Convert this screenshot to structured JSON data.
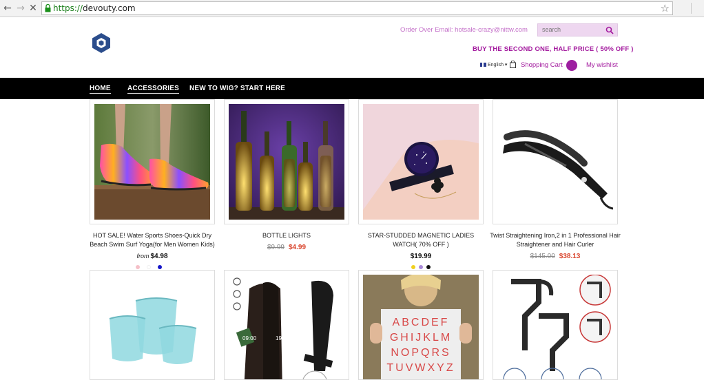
{
  "browser": {
    "url_scheme": "https://",
    "url_host": "devouty.com"
  },
  "header": {
    "order_email": "Order Over Email: hotsale-crazy@nittw.com",
    "search_placeholder": "search",
    "promo": "BUY THE SECOND ONE, HALF PRICE ( 50% OFF )",
    "language": "English",
    "cart_label": "Shopping Cart",
    "wishlist_label": "My wishlist"
  },
  "nav": {
    "items": [
      "HOME",
      "ACCESSORIES",
      "NEW TO WIG? START HERE"
    ]
  },
  "products": [
    {
      "title": "HOT SALE! Water Sports Shoes-Quick Dry Beach Swim Surf Yoga(for Men Women Kids)",
      "price_prefix": "from",
      "price": "$4.98",
      "swatches": [
        "#f5c0c8",
        "#ffffff",
        "#1616c8"
      ]
    },
    {
      "title": "BOTTLE LIGHTS",
      "old_price": "$9.99",
      "price": "$4.99"
    },
    {
      "title": "STAR-STUDDED MAGNETIC LADIES WATCH( 70% OFF )",
      "price": "$19.99",
      "swatches": [
        "#f0d020",
        "#a98ad8",
        "#111111"
      ]
    },
    {
      "title": "Twist Straightening Iron,2 in 1 Professional Hair Straightener and Hair Curler",
      "old_price": "$145.00",
      "price": "$38.13"
    }
  ],
  "image_labels": {
    "straightener_left": "09:00",
    "straightener_right": "19:00",
    "alphabet_row1": "ABCDEF",
    "alphabet_row2": "GHIJKLM",
    "alphabet_row3": "NOPQRS",
    "alphabet_row4": "TUVWXYZ"
  }
}
